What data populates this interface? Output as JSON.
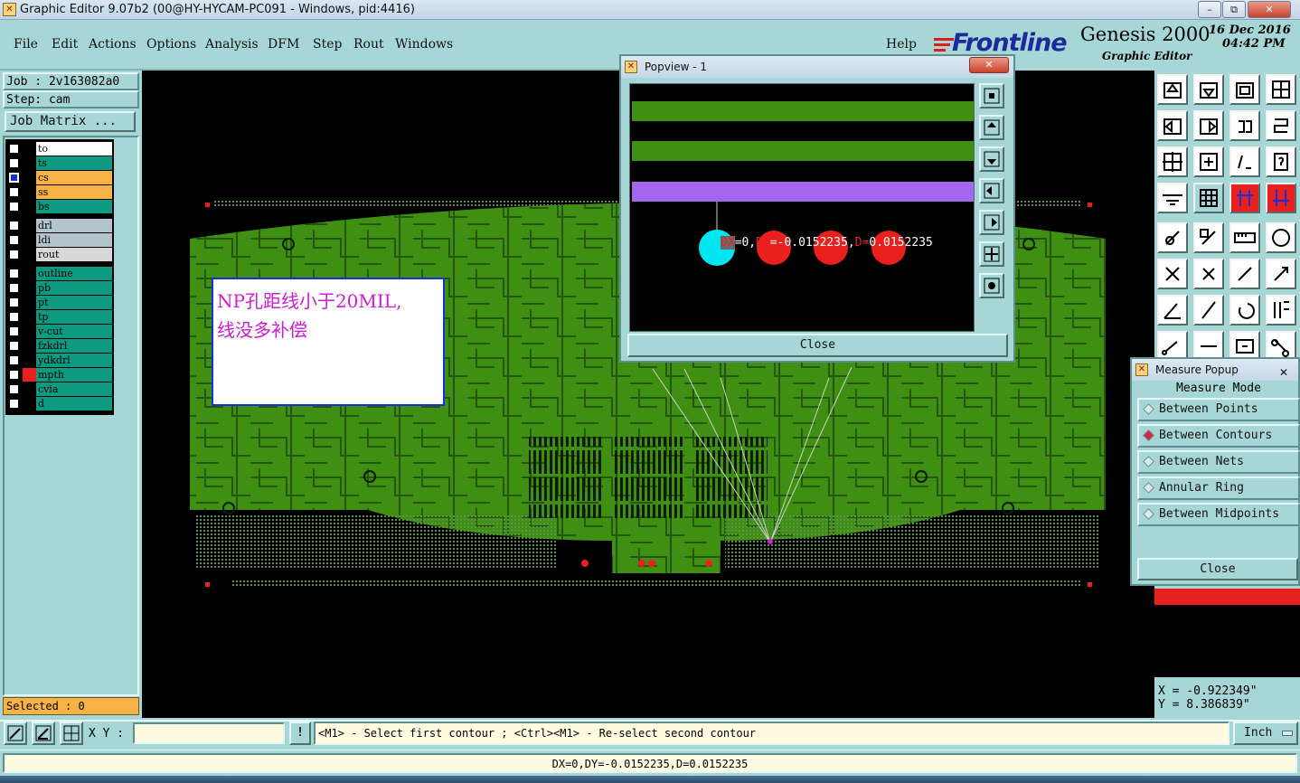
{
  "window": {
    "title": "Graphic Editor 9.07b2 (00@HY-HYCAM-PC091 - Windows, pid:4416)",
    "minimize": "–",
    "restore": "⧉",
    "close": "✕"
  },
  "menu": [
    "File",
    "Edit",
    "Actions",
    "Options",
    "Analysis",
    "DFM",
    "Step",
    "Rout",
    "Windows"
  ],
  "help": "Help",
  "brand": {
    "logo": "Frontline",
    "product": "Genesis 2000",
    "subtitle": "Graphic Editor",
    "date": "16 Dec 2016",
    "time": "04:42 PM"
  },
  "job": {
    "job_label": "Job : 2v163082a0",
    "step_label": "Step: cam",
    "matrix_button": "Job Matrix ..."
  },
  "layers": [
    {
      "name": "to",
      "bg": "#ffffff"
    },
    {
      "name": "ts",
      "bg": "#0d9a80"
    },
    {
      "name": "cs",
      "bg": "#f7b245",
      "active": true
    },
    {
      "name": "ss",
      "bg": "#f7b245"
    },
    {
      "name": "bs",
      "bg": "#0d9a80"
    },
    {
      "name": "drl",
      "bg": "#b4c4cc"
    },
    {
      "name": "ldi",
      "bg": "#b4c4cc"
    },
    {
      "name": "rout",
      "bg": "#d8d8d8"
    },
    {
      "name": "outline",
      "bg": "#0d9a80"
    },
    {
      "name": "pb",
      "bg": "#0d9a80"
    },
    {
      "name": "pt",
      "bg": "#0d9a80"
    },
    {
      "name": "tp",
      "bg": "#0d9a80"
    },
    {
      "name": "v-cut",
      "bg": "#0d9a80"
    },
    {
      "name": "fzkdrl",
      "bg": "#0d9a80"
    },
    {
      "name": "ydkdrl",
      "bg": "#0d9a80"
    },
    {
      "name": "mpth",
      "bg": "#0d9a80",
      "swatch": "#e8201e"
    },
    {
      "name": "cvia",
      "bg": "#0d9a80"
    },
    {
      "name": "d",
      "bg": "#0d9a80"
    }
  ],
  "selected": "Selected : 0",
  "annotation": {
    "line1": "NP孔距线小于20MIL,",
    "line2": "线没多补偿"
  },
  "popview": {
    "title": "Popview - 1",
    "readout": {
      "dx": "DX",
      "dx_rest": "=0,",
      "dy": "DY",
      "dy_rest": "=-0.0152235,",
      "d": "D=",
      "d_rest": "0.0152235"
    },
    "close": "Close"
  },
  "measure": {
    "title": "Measure Popup",
    "header": "Measure Mode",
    "modes": [
      "Between Points",
      "Between Contours",
      "Between Nets",
      "Annular Ring",
      "Between Midpoints"
    ],
    "selected_mode": "Between Contours",
    "close": "Close"
  },
  "coords": {
    "x": "X = -0.922349\"",
    "y": "Y = 8.386839\""
  },
  "statusbar": {
    "xy_label": "X Y :",
    "xy_value": "",
    "hint": "<M1> - Select first contour ; <Ctrl><M1> - Re-select second contour",
    "unit": "Inch",
    "result": "DX=0,DY=-0.0152235,D=0.0152235"
  },
  "colors": {
    "board": "#3f8f12",
    "panel": "#a6d7d6",
    "measure_red": "#e8201e",
    "measure_cyan": "#00e6f0",
    "purple_strip": "#a366ee",
    "annotation_text": "#d11bd8",
    "annotation_border": "#1b2fd8"
  }
}
